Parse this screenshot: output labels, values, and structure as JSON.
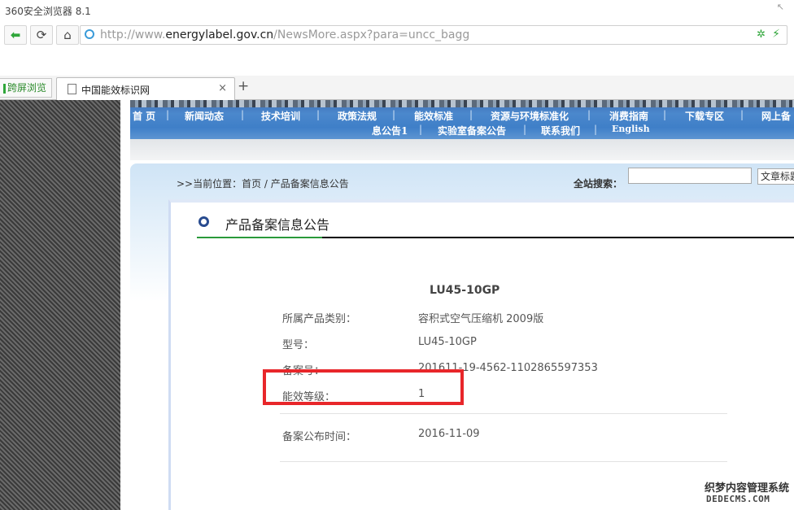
{
  "browser": {
    "app_title": "360安全浏览器 8.1",
    "url_prefix": "http://www.",
    "url_domain": "energylabel.gov.cn",
    "url_path": "/NewsMore.aspx?para=uncc_bagg",
    "split_toggle_label": "跨屏浏览",
    "tab_title": "中国能效标识网",
    "tab_close": "×",
    "new_tab": "+",
    "back_glyph": "⬅",
    "refresh_glyph": "⟳",
    "home_glyph": "⌂",
    "secure_glyph": "✲",
    "bolt_glyph": "⚡",
    "corner_glyph": "↖"
  },
  "site_nav": {
    "row1": [
      "首 页",
      "新闻动态",
      "技术培训",
      "政策法规",
      "能效标准",
      "资源与环境标准化",
      "消费指南",
      "下载专区",
      "网上备"
    ],
    "row2": [
      "息公告1",
      "实验室备案公告",
      "联系我们",
      "English"
    ],
    "separator": "|"
  },
  "breadcrumb": ">>当前位置：首页 / 产品备案信息公告",
  "search": {
    "label": "全站搜索：",
    "input_value": "",
    "type_selected": "文章标题"
  },
  "article": {
    "heading": "产品备案信息公告",
    "model_title": "LU45-10GP",
    "fields": [
      {
        "label": "所属产品类别：",
        "value": "容积式空气压缩机 2009版"
      },
      {
        "label": "型号：",
        "value": "LU45-10GP"
      },
      {
        "label": "备案号：",
        "value": "201611-19-4562-1102865597353"
      },
      {
        "label": "能效等级：",
        "value": "1"
      },
      {
        "label": "备案公布时间：",
        "value": "2016-11-09"
      }
    ]
  },
  "annotation_color": "#e8262a",
  "watermark": {
    "line1": "织梦内容管理系统",
    "line2": "DEDECMS.COM"
  }
}
